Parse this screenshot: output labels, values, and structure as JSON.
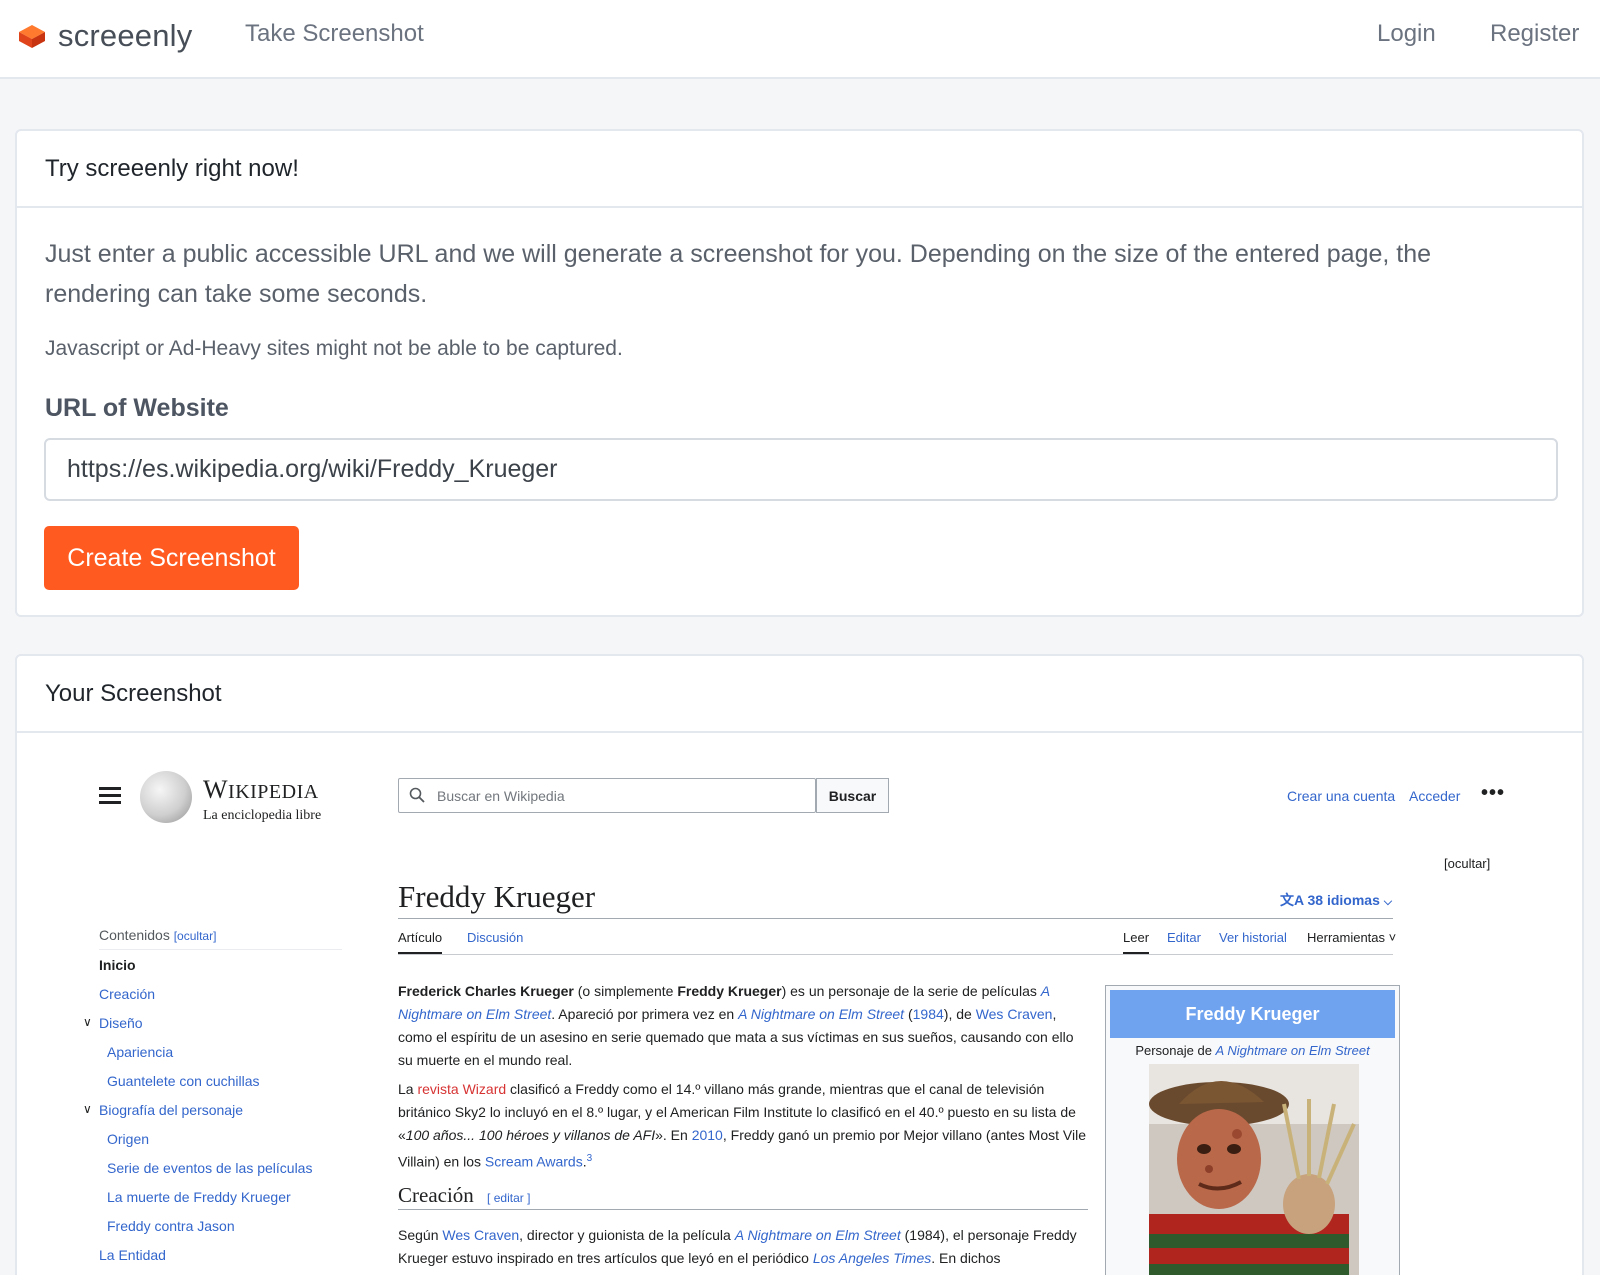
{
  "nav": {
    "brand": "screeenly",
    "take_screenshot": "Take Screenshot",
    "login": "Login",
    "register": "Register",
    "brand_color": "#ff5a1f"
  },
  "try_card": {
    "header": "Try screeenly right now!",
    "lead": "Just enter a public accessible URL and we will generate a screenshot for you. Depending on the size of the entered page, the rendering can take some seconds.",
    "note": "Javascript or Ad-Heavy sites might not be able to be captured.",
    "url_label": "URL of Website",
    "url_value": "https://es.wikipedia.org/wiki/Freddy_Krueger",
    "button": "Create Screenshot"
  },
  "result_card": {
    "header": "Your Screenshot"
  },
  "wiki": {
    "wordmark": "Wikipedia",
    "wordmark_sub": "La enciclopedia libre",
    "search_placeholder": "Buscar en Wikipedia",
    "search_button": "Buscar",
    "crear_cuenta": "Crear una cuenta",
    "acceder": "Acceder",
    "more": "•••",
    "ocultar_top": "[ocultar]",
    "title": "Freddy Krueger",
    "idiomas": "38 idiomas",
    "tabs_left": [
      "Artículo",
      "Discusión"
    ],
    "tabs_right": [
      "Leer",
      "Editar",
      "Ver historial",
      "Herramientas"
    ],
    "toc_title": "Contenidos",
    "toc_hide": "[ocultar]",
    "toc": [
      {
        "label": "Inicio"
      },
      {
        "label": "Creación"
      },
      {
        "label": "Diseño"
      },
      {
        "label": "Apariencia"
      },
      {
        "label": "Guantelete con cuchillas"
      },
      {
        "label": "Biografía del personaje"
      },
      {
        "label": "Origen"
      },
      {
        "label": "Serie de eventos de las películas"
      },
      {
        "label": "La muerte de Freddy Krueger"
      },
      {
        "label": "Freddy contra Jason"
      },
      {
        "label": "La Entidad"
      }
    ],
    "p1": {
      "a": "Frederick Charles Krueger",
      "b": " (o simplemente ",
      "c": "Freddy Krueger",
      "d": ") es un personaje de la serie de películas ",
      "e": "A Nightmare on Elm Street",
      "f": ". Apareció por primera vez en ",
      "g": "A Nightmare on Elm Street",
      "h": " (",
      "i": "1984",
      "j": "), de ",
      "k": "Wes Craven",
      "l": ", como el espíritu de un asesino en serie quemado que mata a sus víctimas en sus sueños, causando con ello su muerte en el mundo real."
    },
    "p2": {
      "a": "La ",
      "b": "revista Wizard",
      "c": " clasificó a Freddy como el 14.º villano más grande, mientras que el canal de televisión británico Sky2 lo incluyó en el 8.º lugar, y el American Film Institute lo clasificó en el 40.º puesto en su lista de «",
      "d": "100 años... 100 héroes y villanos de AFI",
      "e": "». En ",
      "f": "2010",
      "g": ", Freddy ganó un premio por Mejor villano (antes Most Vile Villain) en los ",
      "h": "Scream Awards",
      "i": ".",
      "j": "3"
    },
    "section": "Creación",
    "section_edit": "[ editar ]",
    "p3": {
      "a": "Según ",
      "b": "Wes Craven",
      "c": ", director y guionista de la película ",
      "d": "A Nightmare on Elm Street",
      "e": " (1984), el personaje Freddy Krueger estuvo inspirado en tres artículos que leyó en el periódico ",
      "f": "Los Angeles Times",
      "g": ". En dichos"
    },
    "infobox": {
      "title": "Freddy Krueger",
      "sub_a": "Personaje de ",
      "sub_b": "A Nightmare on Elm Street"
    }
  }
}
